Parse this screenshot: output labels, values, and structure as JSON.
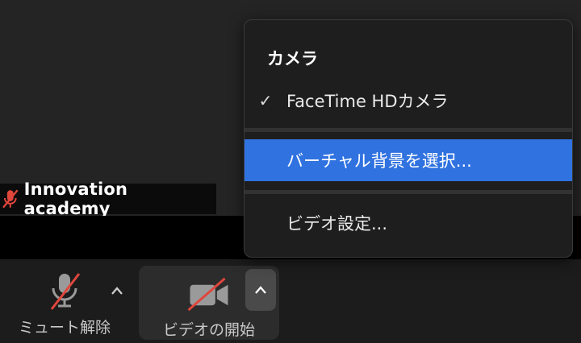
{
  "participant": {
    "name": "Innovation academy"
  },
  "toolbar": {
    "mute_label": "ミュート解除",
    "video_label": "ビデオの開始"
  },
  "menu": {
    "section_title": "カメラ",
    "items": [
      {
        "label": "FaceTime HDカメラ",
        "checked": true
      },
      {
        "label": "バーチャル背景を選択...",
        "highlighted": true
      },
      {
        "label": "ビデオ設定..."
      }
    ]
  },
  "colors": {
    "highlight": "#2f72e0",
    "muted_red": "#e0463c",
    "toolbar_bg": "#1c1c1c"
  },
  "icons": [
    "mic-off-icon",
    "video-off-icon",
    "chevron-up-icon",
    "checkmark-icon"
  ]
}
